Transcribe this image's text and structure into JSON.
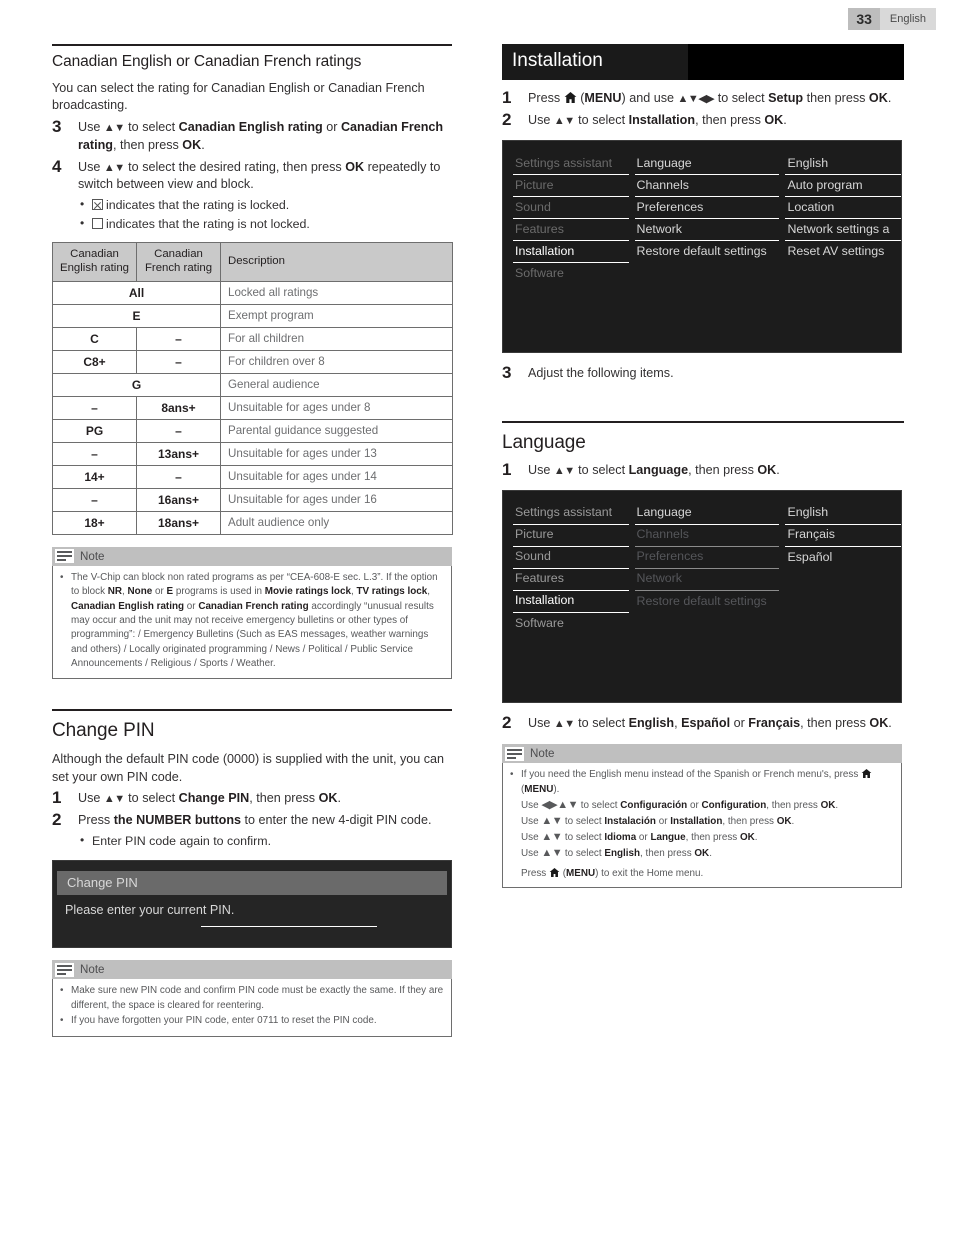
{
  "header": {
    "page_number": "33",
    "language": "English"
  },
  "left": {
    "section1": {
      "title": "Canadian English or Canadian French ratings",
      "intro": "You can select the rating for Canadian English or Canadian French broadcasting.",
      "steps": [
        {
          "num": "3",
          "text_parts": [
            "Use ",
            "▲▼",
            " to select ",
            "Canadian English rating",
            " or ",
            "Canadian French rating",
            ", then press ",
            "OK",
            "."
          ]
        },
        {
          "num": "4",
          "text_parts": [
            "Use ",
            "▲▼",
            " to select the desired rating, then press ",
            "OK",
            " repeatedly to switch between view and block."
          ]
        }
      ],
      "bullets": [
        {
          "icon": "checkbox-checked",
          "text": "indicates that the rating is locked."
        },
        {
          "icon": "checkbox-empty",
          "text": "indicates that the rating is not locked."
        }
      ],
      "table": {
        "headers": [
          "Canadian English rating",
          "Canadian French rating",
          "Description"
        ],
        "rows": [
          {
            "span": true,
            "english": "All",
            "french": "",
            "desc": "Locked all ratings"
          },
          {
            "span": true,
            "english": "E",
            "french": "",
            "desc": "Exempt program"
          },
          {
            "span": false,
            "english": "C",
            "french": "–",
            "desc": "For all children"
          },
          {
            "span": false,
            "english": "C8+",
            "french": "–",
            "desc": "For children over 8"
          },
          {
            "span": true,
            "english": "G",
            "french": "",
            "desc": "General audience"
          },
          {
            "span": false,
            "english": "–",
            "french": "8ans+",
            "desc": "Unsuitable for ages under 8"
          },
          {
            "span": false,
            "english": "PG",
            "french": "–",
            "desc": "Parental guidance suggested"
          },
          {
            "span": false,
            "english": "–",
            "french": "13ans+",
            "desc": "Unsuitable for ages under 13"
          },
          {
            "span": false,
            "english": "14+",
            "french": "–",
            "desc": "Unsuitable for ages under 14"
          },
          {
            "span": false,
            "english": "–",
            "french": "16ans+",
            "desc": "Unsuitable for ages under 16"
          },
          {
            "span": false,
            "english": "18+",
            "french": "18ans+",
            "desc": "Adult audience only"
          }
        ]
      },
      "note": {
        "title": "Note",
        "bullets": [
          "The V-Chip can block non rated programs as per “CEA-608-E sec. L.3”. If the option to block NR, None or E programs is used in Movie ratings lock, TV ratings lock, Canadian English rating or Canadian French rating accordingly “unusual results may occur and the unit may not receive emergency bulletins or other types of programming”: / Emergency Bulletins (Such as EAS messages, weather warnings and others) / Locally originated programming / News / Political / Public Service Announcements / Religious / Sports / Weather."
        ]
      }
    },
    "section2": {
      "title": "Change PIN",
      "intro": "Although the default PIN code (0000) is supplied with the unit, you can set your own PIN code.",
      "steps": [
        {
          "num": "1",
          "text": "Use ▲▼ to select Change PIN, then press OK."
        },
        {
          "num": "2",
          "text": "Press the NUMBER buttons to enter the new 4-digit PIN code."
        }
      ],
      "bullets": [
        "Enter PIN code again to confirm."
      ],
      "dialog": {
        "title": "Change PIN",
        "message": "Please enter your current PIN.",
        "input_value": ""
      },
      "note": {
        "title": "Note",
        "bullets": [
          "Make sure new PIN code and confirm PIN code must be exactly the same. If they are different, the space is cleared for reentering.",
          "If you have forgotten your PIN code, enter 0711 to reset the PIN code."
        ]
      }
    }
  },
  "right": {
    "section1": {
      "banner_title": "Installation",
      "steps": [
        {
          "num": "1",
          "text": "Press ⌂ (MENU) and use ▲▼◄► to select Setup then press OK."
        },
        {
          "num": "2",
          "text": "Use ▲▼ to select Installation, then press OK."
        },
        {
          "num": "3",
          "text": "Adjust the following items."
        }
      ],
      "menu": {
        "col1": [
          {
            "label": "Settings assistant",
            "state": "dim"
          },
          {
            "label": "Picture",
            "state": "dim"
          },
          {
            "label": "Sound",
            "state": "dim"
          },
          {
            "label": "Features",
            "state": "dim"
          },
          {
            "label": "Installation",
            "state": "selected"
          },
          {
            "label": "Software",
            "state": "dim"
          }
        ],
        "col2": [
          {
            "label": "Language",
            "state": "normal"
          },
          {
            "label": "Channels",
            "state": "normal"
          },
          {
            "label": "Preferences",
            "state": "normal"
          },
          {
            "label": "Network",
            "state": "normal"
          },
          {
            "label": "Restore default settings",
            "state": "normal"
          }
        ],
        "col3": [
          {
            "label": "English",
            "state": "normal"
          },
          {
            "label": "Auto program",
            "state": "normal"
          },
          {
            "label": "Location",
            "state": "normal"
          },
          {
            "label": "Network settings a",
            "state": "normal"
          },
          {
            "label": "Reset AV settings",
            "state": "normal"
          }
        ]
      }
    },
    "section2": {
      "title": "Language",
      "steps": [
        {
          "num": "1",
          "text": "Use ▲▼ to select Language, then press OK."
        },
        {
          "num": "2",
          "text": "Use ▲▼ to select English, Español or Français, then press OK."
        }
      ],
      "menu": {
        "col1": [
          {
            "label": "Settings assistant",
            "state": "mid"
          },
          {
            "label": "Picture",
            "state": "mid"
          },
          {
            "label": "Sound",
            "state": "mid"
          },
          {
            "label": "Features",
            "state": "mid"
          },
          {
            "label": "Installation",
            "state": "selected"
          },
          {
            "label": "Software",
            "state": "mid"
          }
        ],
        "col2": [
          {
            "label": "Language",
            "state": "normal"
          },
          {
            "label": "Channels",
            "state": "dim"
          },
          {
            "label": "Preferences",
            "state": "dim"
          },
          {
            "label": "Network",
            "state": "dim"
          },
          {
            "label": "Restore default settings",
            "state": "dim"
          }
        ],
        "col3": [
          {
            "label": "English",
            "state": "normal"
          },
          {
            "label": "Français",
            "state": "normal"
          },
          {
            "label": "Español",
            "state": "normal"
          }
        ]
      },
      "note": {
        "title": "Note",
        "line1": "If you need the English menu instead of the Spanish or French menu's, press ⌂ (MENU).",
        "line2": "Use ◄►▲▼ to select Configuración or Configuration, then press OK.",
        "line3": "Use ▲▼ to select Instalación or Installation, then press OK.",
        "line4": "Use ▲▼ to select Idioma or Langue, then press OK.",
        "line5": "Use ▲▼ to select English, then press OK.",
        "line6": "Press ⌂ (MENU) to exit the Home menu."
      }
    }
  }
}
